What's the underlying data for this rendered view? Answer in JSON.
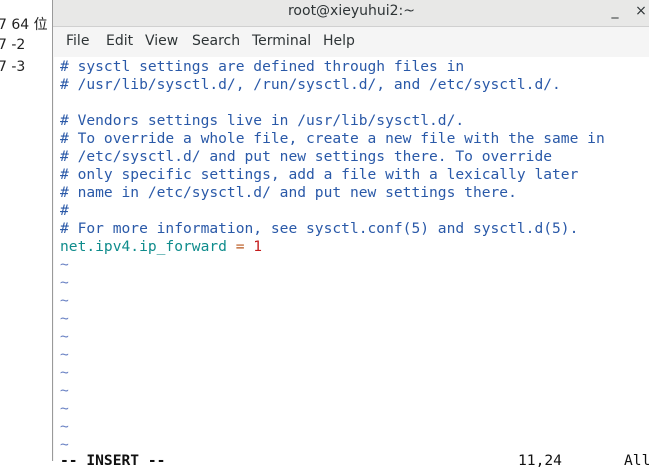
{
  "left_strip": {
    "lines": [
      "7 64 位",
      "7 -2",
      "7 -3"
    ]
  },
  "window": {
    "title": "root@xieyuhui2:~",
    "minimize_glyph": "_",
    "close_glyph": "×"
  },
  "menu": [
    "File",
    "Edit",
    "View",
    "Search",
    "Terminal",
    "Help"
  ],
  "editor": {
    "comment_lines": [
      "# sysctl settings are defined through files in",
      "# /usr/lib/sysctl.d/, /run/sysctl.d/, and /etc/sysctl.d/.",
      "",
      "# Vendors settings live in /usr/lib/sysctl.d/.",
      "# To override a whole file, create a new file with the same in",
      "# /etc/sysctl.d/ and put new settings there. To override",
      "# only specific settings, add a file with a lexically later",
      "# name in /etc/sysctl.d/ and put new settings there.",
      "#",
      "# For more information, see sysctl.conf(5) and sysctl.d(5)."
    ],
    "setting": {
      "key": "net.ipv4.ip_forward",
      "eq": " = ",
      "value": "1"
    },
    "tilde": "~",
    "tilde_count": 11
  },
  "status": {
    "mode": "-- INSERT --",
    "position": "11,24",
    "scroll": "All"
  },
  "colors": {
    "comment": "#2a59a8",
    "key": "#0f8c8c",
    "value": "#c41c1c",
    "tilde": "#6a82c4"
  }
}
